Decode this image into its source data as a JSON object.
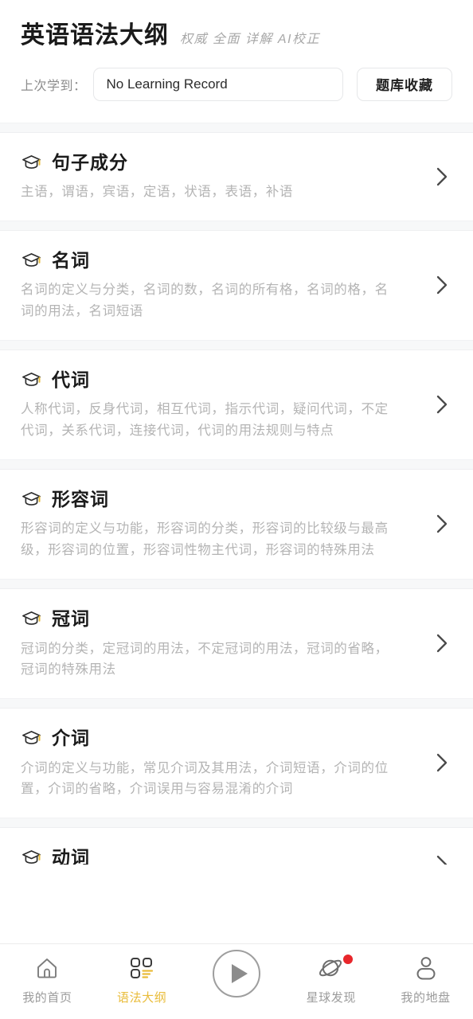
{
  "header": {
    "title": "英语语法大纲",
    "subtitle": "权威 全面 详解 AI校正",
    "record_label": "上次学到：",
    "record_value": "No Learning Record",
    "favorites_button": "题库收藏"
  },
  "list": {
    "items": [
      {
        "title": "句子成分",
        "desc": "主语，谓语，宾语，定语，状语，表语，补语",
        "icon": "graduation-cap-icon",
        "chevron": "chevron-right-icon"
      },
      {
        "title": "名词",
        "desc": "名词的定义与分类，名词的数，名词的所有格，名词的格，名词的用法，名词短语",
        "icon": "graduation-cap-icon",
        "chevron": "chevron-right-icon"
      },
      {
        "title": "代词",
        "desc": "人称代词，反身代词，相互代词，指示代词，疑问代词，不定代词，关系代词，连接代词，代词的用法规则与特点",
        "icon": "graduation-cap-icon",
        "chevron": "chevron-right-icon"
      },
      {
        "title": "形容词",
        "desc": "形容词的定义与功能，形容词的分类，形容词的比较级与最高级，形容词的位置，形容词性物主代词，形容词的特殊用法",
        "icon": "graduation-cap-icon",
        "chevron": "chevron-right-icon"
      },
      {
        "title": "冠词",
        "desc": "冠词的分类，定冠词的用法，不定冠词的用法，冠词的省略，冠词的特殊用法",
        "icon": "graduation-cap-icon",
        "chevron": "chevron-right-icon"
      },
      {
        "title": "介词",
        "desc": "介词的定义与功能，常见介词及其用法，介词短语，介词的位置，介词的省略，介词误用与容易混淆的介词",
        "icon": "graduation-cap-icon",
        "chevron": "chevron-right-icon"
      },
      {
        "title": "动词",
        "desc": "",
        "icon": "graduation-cap-icon",
        "chevron": "chevron-right-icon"
      }
    ]
  },
  "tabbar": {
    "items": [
      {
        "label": "我的首页",
        "icon": "home-icon",
        "active": false
      },
      {
        "label": "语法大纲",
        "icon": "grid-list-icon",
        "active": true
      },
      {
        "label": "",
        "icon": "play-circle-icon",
        "active": false
      },
      {
        "label": "星球发现",
        "icon": "planet-icon",
        "active": false,
        "badge": true
      },
      {
        "label": "我的地盘",
        "icon": "person-icon",
        "active": false
      }
    ]
  },
  "colors": {
    "accent": "#e9bc3a",
    "badge": "#e8262b",
    "text_primary": "#1b1b1b",
    "text_muted": "#b4b4b4",
    "border": "#e6e7e9",
    "separator": "#f7f8f9"
  }
}
